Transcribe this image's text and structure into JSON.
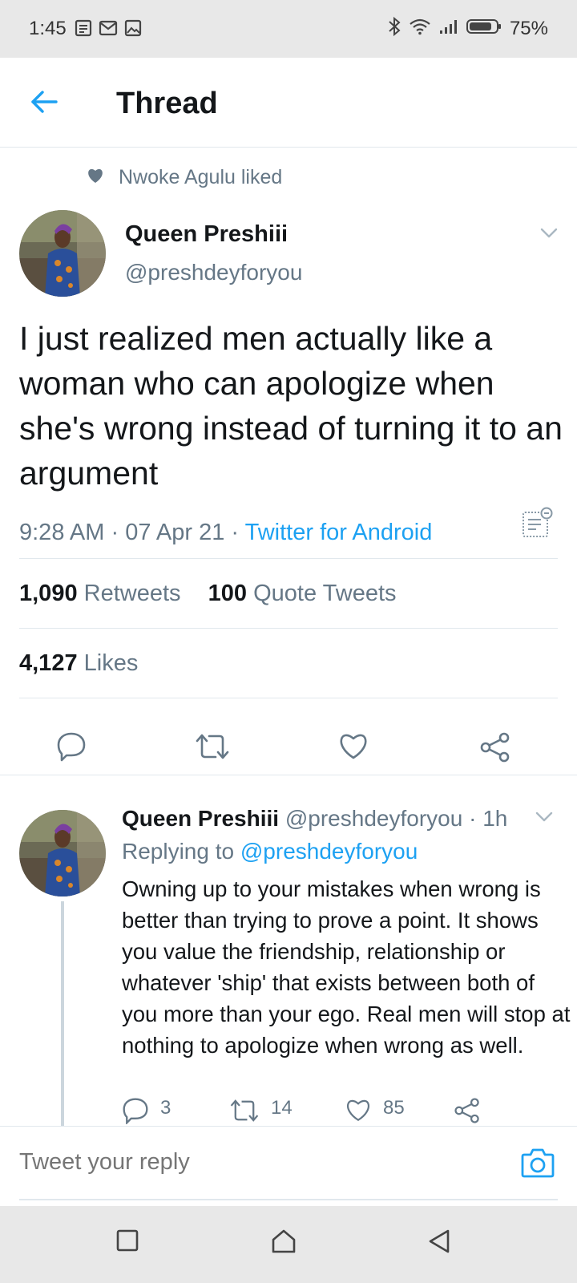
{
  "status_bar": {
    "time": "1:45",
    "battery": "75%"
  },
  "header": {
    "title": "Thread"
  },
  "social_context": {
    "text": "Nwoke Agulu liked"
  },
  "tweet": {
    "author_name": "Queen Preshiii",
    "author_handle": "@preshdeyforyou",
    "text": "I just realized men actually like a woman who can apologize when she's wrong instead of turning it to an argument",
    "time": "9:28 AM",
    "date": "07 Apr 21",
    "source": "Twitter for Android",
    "retweets_count": "1,090",
    "retweets_label": "Retweets",
    "quotes_count": "100",
    "quotes_label": "Quote Tweets",
    "likes_count": "4,127",
    "likes_label": "Likes"
  },
  "reply": {
    "author_name": "Queen Preshiii",
    "author_handle": "@preshdeyforyou",
    "age": "1h",
    "replying_label": "Replying to",
    "replying_to": "@preshdeyforyou",
    "text": "Owning up to your mistakes when wrong is better than trying to prove a point. It shows you value the friendship, relationship or whatever 'ship' that exists between both of you more than your ego. Real men will stop at nothing to apologize when wrong as well.",
    "reply_count": "3",
    "retweet_count": "14",
    "like_count": "85"
  },
  "compose": {
    "placeholder": "Tweet your reply"
  },
  "colors": {
    "accent": "#1da1f2",
    "secondary_text": "#657786",
    "divider": "#e1e8ed"
  }
}
